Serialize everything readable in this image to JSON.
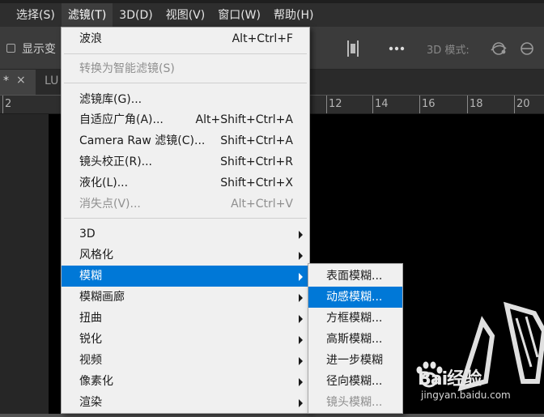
{
  "menubar": {
    "items": [
      {
        "label": "选择(S)"
      },
      {
        "label": "滤镜(T)"
      },
      {
        "label": "3D(D)"
      },
      {
        "label": "视图(V)"
      },
      {
        "label": "窗口(W)"
      },
      {
        "label": "帮助(H)"
      }
    ]
  },
  "options_bar": {
    "checkbox_label": "显示变",
    "mode_label": "3D 模式:"
  },
  "tabs": {
    "active_star": "*",
    "active_close": "×",
    "second_label": "LU"
  },
  "ruler": {
    "labels": [
      "2",
      "12",
      "14",
      "16",
      "18",
      "20"
    ]
  },
  "filter_menu": {
    "items": [
      {
        "label": "波浪",
        "shortcut": "Alt+Ctrl+F",
        "disabled": false
      },
      {
        "label": "转换为智能滤镜(S)",
        "shortcut": "",
        "disabled": true
      },
      {
        "label": "滤镜库(G)...",
        "shortcut": "",
        "disabled": false
      },
      {
        "label": "自适应广角(A)...",
        "shortcut": "Alt+Shift+Ctrl+A",
        "disabled": false
      },
      {
        "label": "Camera Raw 滤镜(C)...",
        "shortcut": "Shift+Ctrl+A",
        "disabled": false
      },
      {
        "label": "镜头校正(R)...",
        "shortcut": "Shift+Ctrl+R",
        "disabled": false
      },
      {
        "label": "液化(L)...",
        "shortcut": "Shift+Ctrl+X",
        "disabled": false
      },
      {
        "label": "消失点(V)...",
        "shortcut": "Alt+Ctrl+V",
        "disabled": true
      },
      {
        "label": "3D",
        "shortcut": "",
        "disabled": false
      },
      {
        "label": "风格化",
        "shortcut": "",
        "disabled": false
      },
      {
        "label": "模糊",
        "shortcut": "",
        "disabled": false
      },
      {
        "label": "模糊画廊",
        "shortcut": "",
        "disabled": false
      },
      {
        "label": "扭曲",
        "shortcut": "",
        "disabled": false
      },
      {
        "label": "锐化",
        "shortcut": "",
        "disabled": false
      },
      {
        "label": "视频",
        "shortcut": "",
        "disabled": false
      },
      {
        "label": "像素化",
        "shortcut": "",
        "disabled": false
      },
      {
        "label": "渲染",
        "shortcut": "",
        "disabled": false
      }
    ]
  },
  "blur_submenu": {
    "items": [
      {
        "label": "表面模糊..."
      },
      {
        "label": "动感模糊..."
      },
      {
        "label": "方框模糊..."
      },
      {
        "label": "高斯模糊..."
      },
      {
        "label": "进一步模糊"
      },
      {
        "label": "径向模糊..."
      },
      {
        "label": "镜头模糊..."
      }
    ]
  },
  "watermark": {
    "brand": "Bai经验",
    "url": "jingyan.baidu.com"
  },
  "colors": {
    "menu_highlight": "#0078d7",
    "menu_background": "#f0f0f0",
    "app_background": "#535353"
  }
}
